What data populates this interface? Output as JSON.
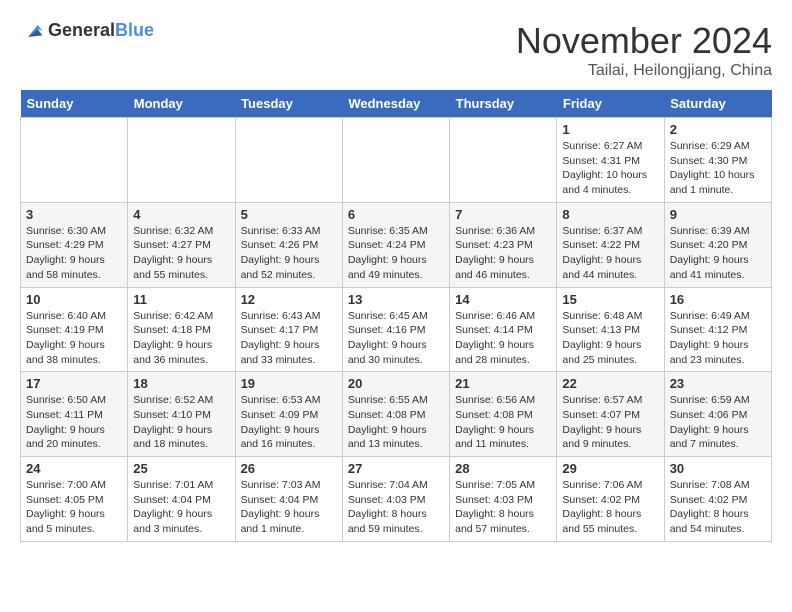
{
  "header": {
    "logo_general": "General",
    "logo_blue": "Blue",
    "month_title": "November 2024",
    "location": "Tailai, Heilongjiang, China"
  },
  "weekdays": [
    "Sunday",
    "Monday",
    "Tuesday",
    "Wednesday",
    "Thursday",
    "Friday",
    "Saturday"
  ],
  "weeks": [
    [
      {
        "day": "",
        "info": ""
      },
      {
        "day": "",
        "info": ""
      },
      {
        "day": "",
        "info": ""
      },
      {
        "day": "",
        "info": ""
      },
      {
        "day": "",
        "info": ""
      },
      {
        "day": "1",
        "info": "Sunrise: 6:27 AM\nSunset: 4:31 PM\nDaylight: 10 hours\nand 4 minutes."
      },
      {
        "day": "2",
        "info": "Sunrise: 6:29 AM\nSunset: 4:30 PM\nDaylight: 10 hours\nand 1 minute."
      }
    ],
    [
      {
        "day": "3",
        "info": "Sunrise: 6:30 AM\nSunset: 4:29 PM\nDaylight: 9 hours\nand 58 minutes."
      },
      {
        "day": "4",
        "info": "Sunrise: 6:32 AM\nSunset: 4:27 PM\nDaylight: 9 hours\nand 55 minutes."
      },
      {
        "day": "5",
        "info": "Sunrise: 6:33 AM\nSunset: 4:26 PM\nDaylight: 9 hours\nand 52 minutes."
      },
      {
        "day": "6",
        "info": "Sunrise: 6:35 AM\nSunset: 4:24 PM\nDaylight: 9 hours\nand 49 minutes."
      },
      {
        "day": "7",
        "info": "Sunrise: 6:36 AM\nSunset: 4:23 PM\nDaylight: 9 hours\nand 46 minutes."
      },
      {
        "day": "8",
        "info": "Sunrise: 6:37 AM\nSunset: 4:22 PM\nDaylight: 9 hours\nand 44 minutes."
      },
      {
        "day": "9",
        "info": "Sunrise: 6:39 AM\nSunset: 4:20 PM\nDaylight: 9 hours\nand 41 minutes."
      }
    ],
    [
      {
        "day": "10",
        "info": "Sunrise: 6:40 AM\nSunset: 4:19 PM\nDaylight: 9 hours\nand 38 minutes."
      },
      {
        "day": "11",
        "info": "Sunrise: 6:42 AM\nSunset: 4:18 PM\nDaylight: 9 hours\nand 36 minutes."
      },
      {
        "day": "12",
        "info": "Sunrise: 6:43 AM\nSunset: 4:17 PM\nDaylight: 9 hours\nand 33 minutes."
      },
      {
        "day": "13",
        "info": "Sunrise: 6:45 AM\nSunset: 4:16 PM\nDaylight: 9 hours\nand 30 minutes."
      },
      {
        "day": "14",
        "info": "Sunrise: 6:46 AM\nSunset: 4:14 PM\nDaylight: 9 hours\nand 28 minutes."
      },
      {
        "day": "15",
        "info": "Sunrise: 6:48 AM\nSunset: 4:13 PM\nDaylight: 9 hours\nand 25 minutes."
      },
      {
        "day": "16",
        "info": "Sunrise: 6:49 AM\nSunset: 4:12 PM\nDaylight: 9 hours\nand 23 minutes."
      }
    ],
    [
      {
        "day": "17",
        "info": "Sunrise: 6:50 AM\nSunset: 4:11 PM\nDaylight: 9 hours\nand 20 minutes."
      },
      {
        "day": "18",
        "info": "Sunrise: 6:52 AM\nSunset: 4:10 PM\nDaylight: 9 hours\nand 18 minutes."
      },
      {
        "day": "19",
        "info": "Sunrise: 6:53 AM\nSunset: 4:09 PM\nDaylight: 9 hours\nand 16 minutes."
      },
      {
        "day": "20",
        "info": "Sunrise: 6:55 AM\nSunset: 4:08 PM\nDaylight: 9 hours\nand 13 minutes."
      },
      {
        "day": "21",
        "info": "Sunrise: 6:56 AM\nSunset: 4:08 PM\nDaylight: 9 hours\nand 11 minutes."
      },
      {
        "day": "22",
        "info": "Sunrise: 6:57 AM\nSunset: 4:07 PM\nDaylight: 9 hours\nand 9 minutes."
      },
      {
        "day": "23",
        "info": "Sunrise: 6:59 AM\nSunset: 4:06 PM\nDaylight: 9 hours\nand 7 minutes."
      }
    ],
    [
      {
        "day": "24",
        "info": "Sunrise: 7:00 AM\nSunset: 4:05 PM\nDaylight: 9 hours\nand 5 minutes."
      },
      {
        "day": "25",
        "info": "Sunrise: 7:01 AM\nSunset: 4:04 PM\nDaylight: 9 hours\nand 3 minutes."
      },
      {
        "day": "26",
        "info": "Sunrise: 7:03 AM\nSunset: 4:04 PM\nDaylight: 9 hours\nand 1 minute."
      },
      {
        "day": "27",
        "info": "Sunrise: 7:04 AM\nSunset: 4:03 PM\nDaylight: 8 hours\nand 59 minutes."
      },
      {
        "day": "28",
        "info": "Sunrise: 7:05 AM\nSunset: 4:03 PM\nDaylight: 8 hours\nand 57 minutes."
      },
      {
        "day": "29",
        "info": "Sunrise: 7:06 AM\nSunset: 4:02 PM\nDaylight: 8 hours\nand 55 minutes."
      },
      {
        "day": "30",
        "info": "Sunrise: 7:08 AM\nSunset: 4:02 PM\nDaylight: 8 hours\nand 54 minutes."
      }
    ]
  ]
}
